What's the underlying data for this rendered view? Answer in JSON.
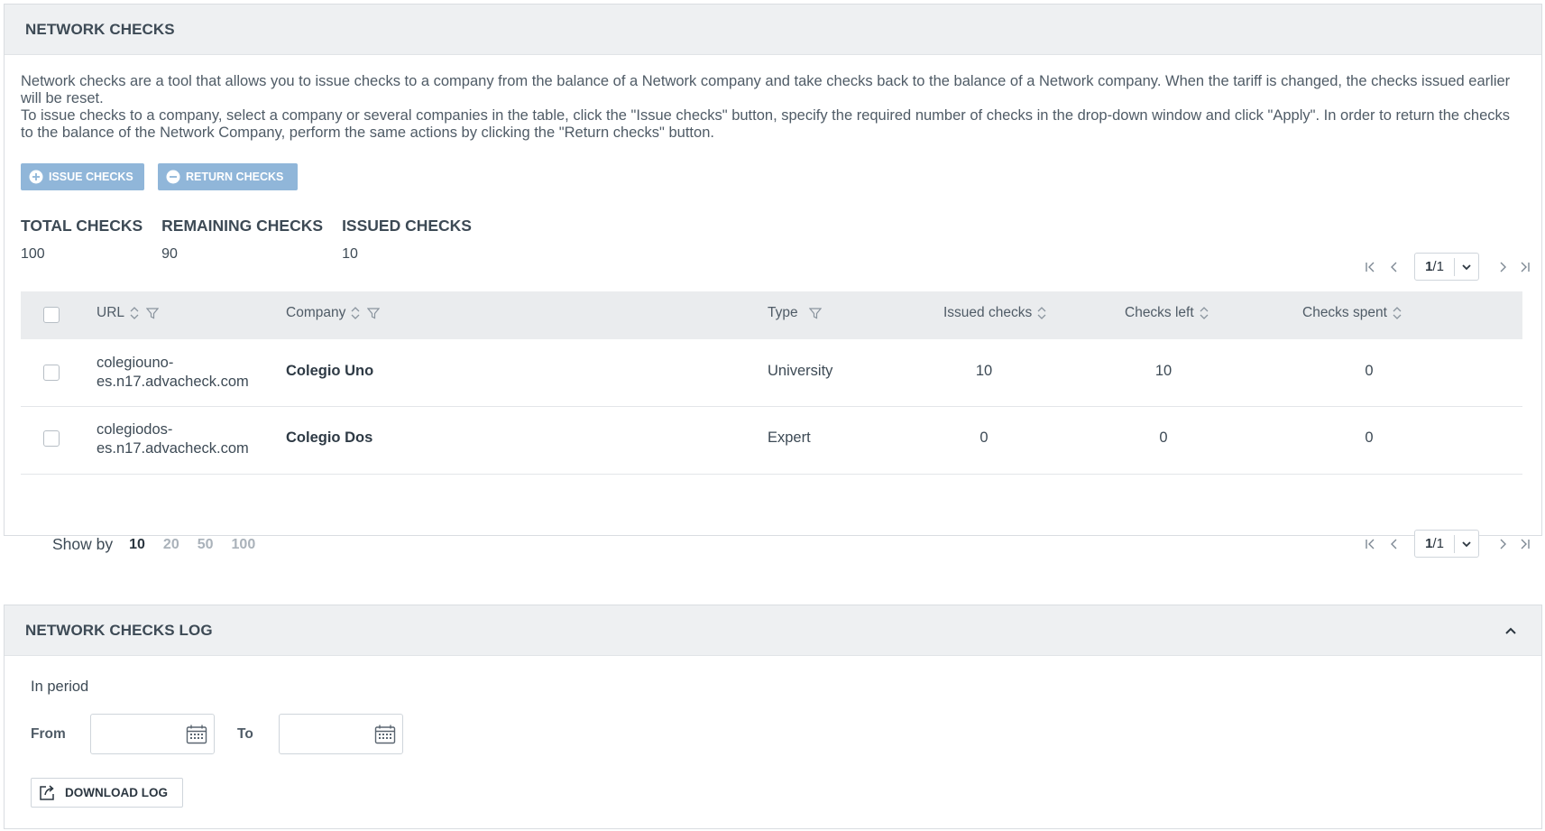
{
  "network_checks": {
    "title": "NETWORK CHECKS",
    "description_1": "Network checks are a tool that allows you to issue checks to a company from the balance of a Network company and take checks back to the balance of a Network company. When the tariff is changed, the checks issued earlier will be reset.",
    "description_2": "To issue checks to a company, select a company or several companies in the table, click the \"Issue checks\" button, specify the required number of checks in the drop-down window and click \"Apply\". In order to return the checks to the balance of the Network Company, perform the same actions by clicking the \"Return checks\" button.",
    "issue_button": "ISSUE CHECKS",
    "return_button": "RETURN CHECKS",
    "stats": {
      "total_label": "TOTAL CHECKS",
      "total_value": "100",
      "remaining_label": "REMAINING CHECKS",
      "remaining_value": "90",
      "issued_label": "ISSUED CHECKS",
      "issued_value": "10"
    },
    "pagination": {
      "current": "1",
      "total": "/1"
    },
    "table": {
      "headers": {
        "url": "URL",
        "company": "Company",
        "type": "Type",
        "issued": "Issued checks",
        "left": "Checks left",
        "spent": "Checks spent"
      },
      "rows": [
        {
          "url_1": "colegiouno-",
          "url_2": "es.n17.advacheck.com",
          "company": "Colegio Uno",
          "type": "University",
          "issued": "10",
          "left": "10",
          "spent": "0"
        },
        {
          "url_1": "colegiodos-",
          "url_2": "es.n17.advacheck.com",
          "company": "Colegio Dos",
          "type": "Expert",
          "issued": "0",
          "left": "0",
          "spent": "0"
        }
      ]
    },
    "show_by": {
      "label": "Show by",
      "options": [
        "10",
        "20",
        "50",
        "100"
      ],
      "selected": "10"
    }
  },
  "log": {
    "title": "NETWORK CHECKS LOG",
    "period_label": "In period",
    "from_label": "From",
    "to_label": "To",
    "from_value": "",
    "to_value": "",
    "download_button": "DOWNLOAD LOG"
  },
  "colors": {
    "accent_button": "#90b6d9",
    "header_bg": "#eef0f2",
    "table_header_bg": "#eaecee",
    "text": "#3d4a55"
  }
}
